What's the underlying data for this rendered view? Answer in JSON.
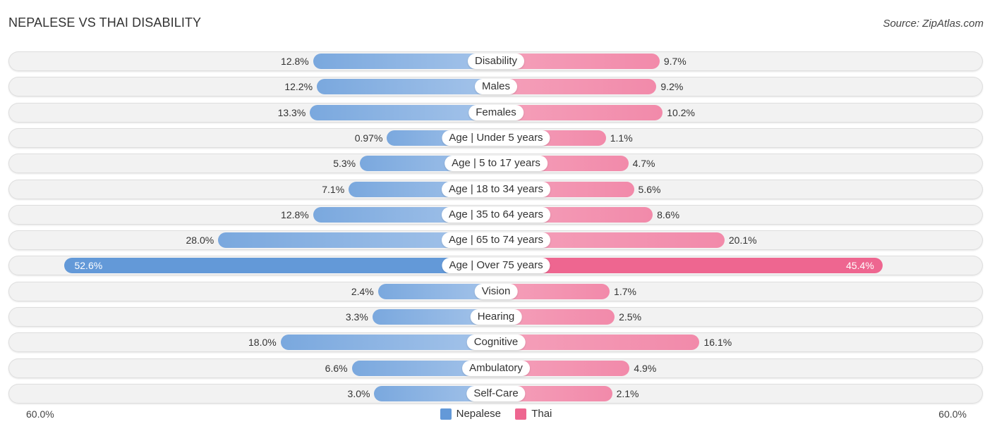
{
  "title": "NEPALESE VS THAI DISABILITY",
  "source": "Source: ZipAtlas.com",
  "colors": {
    "nepalese": "#6399d8",
    "thai": "#ee6690"
  },
  "chart_data": {
    "type": "bar",
    "orientation": "horizontal-diverging",
    "title": "NEPALESE VS THAI DISABILITY",
    "categories": [
      "Disability",
      "Males",
      "Females",
      "Age | Under 5 years",
      "Age | 5 to 17 years",
      "Age | 18 to 34 years",
      "Age | 35 to 64 years",
      "Age | 65 to 74 years",
      "Age | Over 75 years",
      "Vision",
      "Hearing",
      "Cognitive",
      "Ambulatory",
      "Self-Care"
    ],
    "series": [
      {
        "name": "Nepalese",
        "values": [
          12.8,
          12.2,
          13.3,
          0.97,
          5.3,
          7.1,
          12.8,
          28.0,
          52.6,
          2.4,
          3.3,
          18.0,
          6.6,
          3.0
        ],
        "labels": [
          "12.8%",
          "12.2%",
          "13.3%",
          "0.97%",
          "5.3%",
          "7.1%",
          "12.8%",
          "28.0%",
          "52.6%",
          "2.4%",
          "3.3%",
          "18.0%",
          "6.6%",
          "3.0%"
        ]
      },
      {
        "name": "Thai",
        "values": [
          9.7,
          9.2,
          10.2,
          1.1,
          4.7,
          5.6,
          8.6,
          20.1,
          45.4,
          1.7,
          2.5,
          16.1,
          4.9,
          2.1
        ],
        "labels": [
          "9.7%",
          "9.2%",
          "10.2%",
          "1.1%",
          "4.7%",
          "5.6%",
          "8.6%",
          "20.1%",
          "45.4%",
          "1.7%",
          "2.5%",
          "16.1%",
          "4.9%",
          "2.1%"
        ]
      }
    ],
    "highlight_index": 8,
    "axis": {
      "left_label": "60.0%",
      "right_label": "60.0%",
      "range": [
        0,
        60
      ]
    },
    "legend": {
      "placement": "bottom-center",
      "entries": [
        "Nepalese",
        "Thai"
      ]
    },
    "xlabel": "",
    "ylabel": "",
    "grid": false
  }
}
